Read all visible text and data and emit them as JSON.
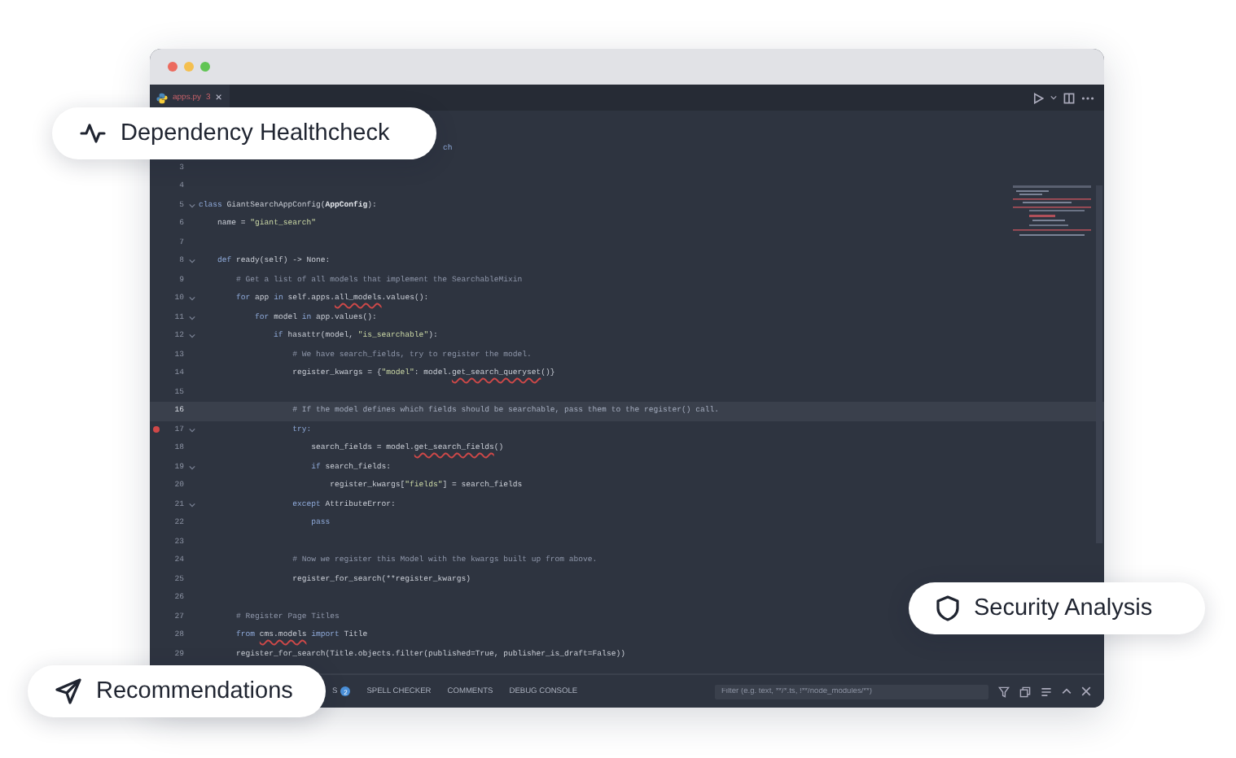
{
  "partial_code_line": {
    "text": "ch"
  },
  "editor_tab": {
    "label": "apps.py",
    "count": "3",
    "close": "×"
  },
  "code_lines": [
    {
      "number": "3",
      "fold": false,
      "highlighted": false,
      "breakpoint": false
    },
    {
      "number": "4",
      "fold": false,
      "highlighted": false,
      "breakpoint": false
    },
    {
      "number": "5",
      "fold": true,
      "highlighted": false,
      "breakpoint": false,
      "segments": [
        {
          "text": "class ",
          "kind": "keyword"
        },
        {
          "text": "GiantSearchAppConfig(",
          "kind": "plain"
        },
        {
          "text": "AppConfig",
          "kind": "bold"
        },
        {
          "text": "):",
          "kind": "plain"
        }
      ]
    },
    {
      "number": "6",
      "fold": false,
      "highlighted": false,
      "breakpoint": false,
      "segments": [
        {
          "text": "    name = ",
          "kind": "plain"
        },
        {
          "text": "\"giant_search\"",
          "kind": "string"
        }
      ]
    },
    {
      "number": "7",
      "fold": false,
      "highlighted": false,
      "breakpoint": false
    },
    {
      "number": "8",
      "fold": true,
      "highlighted": false,
      "breakpoint": false,
      "segments": [
        {
          "text": "    def ",
          "kind": "keyword"
        },
        {
          "text": "ready(self) -> None:",
          "kind": "plain"
        }
      ]
    },
    {
      "number": "9",
      "fold": false,
      "highlighted": false,
      "breakpoint": false,
      "segments": [
        {
          "text": "        # Get a list of all models that implement the SearchableMixin",
          "kind": "comment"
        }
      ]
    },
    {
      "number": "10",
      "fold": true,
      "highlighted": false,
      "breakpoint": false,
      "segments": [
        {
          "text": "        for ",
          "kind": "keyword"
        },
        {
          "text": "app ",
          "kind": "plain"
        },
        {
          "text": "in ",
          "kind": "keyword"
        },
        {
          "text": "self.apps.",
          "kind": "plain"
        },
        {
          "text": "all_models",
          "kind": "error"
        },
        {
          "text": ".values():",
          "kind": "plain"
        }
      ]
    },
    {
      "number": "11",
      "fold": true,
      "highlighted": false,
      "breakpoint": false,
      "segments": [
        {
          "text": "            for ",
          "kind": "keyword"
        },
        {
          "text": "model ",
          "kind": "plain"
        },
        {
          "text": "in ",
          "kind": "keyword"
        },
        {
          "text": "app.values():",
          "kind": "plain"
        }
      ]
    },
    {
      "number": "12",
      "fold": true,
      "highlighted": false,
      "breakpoint": false,
      "segments": [
        {
          "text": "                if ",
          "kind": "keyword"
        },
        {
          "text": "hasattr(model, ",
          "kind": "plain"
        },
        {
          "text": "\"is_searchable\"",
          "kind": "string"
        },
        {
          "text": "):",
          "kind": "plain"
        }
      ]
    },
    {
      "number": "13",
      "fold": false,
      "highlighted": false,
      "breakpoint": false,
      "segments": [
        {
          "text": "                    # We have search_fields, try to register the model.",
          "kind": "comment"
        }
      ]
    },
    {
      "number": "14",
      "fold": false,
      "highlighted": false,
      "breakpoint": false,
      "segments": [
        {
          "text": "                    register_kwargs = {",
          "kind": "plain"
        },
        {
          "text": "\"model\"",
          "kind": "string"
        },
        {
          "text": ": model.",
          "kind": "plain"
        },
        {
          "text": "get_search_queryset",
          "kind": "error"
        },
        {
          "text": "()}",
          "kind": "plain"
        }
      ]
    },
    {
      "number": "15",
      "fold": false,
      "highlighted": false,
      "breakpoint": false
    },
    {
      "number": "16",
      "fold": false,
      "highlighted": true,
      "breakpoint": false,
      "segments": [
        {
          "text": "                    # If the model defines which fields should be searchable, pass them to the register() call.",
          "kind": "comment"
        }
      ]
    },
    {
      "number": "17",
      "fold": true,
      "highlighted": false,
      "breakpoint": true,
      "segments": [
        {
          "text": "                    try:",
          "kind": "keyword"
        }
      ]
    },
    {
      "number": "18",
      "fold": false,
      "highlighted": false,
      "breakpoint": false,
      "segments": [
        {
          "text": "                        search_fields = model.",
          "kind": "plain"
        },
        {
          "text": "get_search_fields",
          "kind": "error"
        },
        {
          "text": "()",
          "kind": "plain"
        }
      ]
    },
    {
      "number": "19",
      "fold": true,
      "highlighted": false,
      "breakpoint": false,
      "segments": [
        {
          "text": "                        if ",
          "kind": "keyword"
        },
        {
          "text": "search_fields:",
          "kind": "plain"
        }
      ]
    },
    {
      "number": "20",
      "fold": false,
      "highlighted": false,
      "breakpoint": false,
      "segments": [
        {
          "text": "                            register_kwargs[",
          "kind": "plain"
        },
        {
          "text": "\"fields\"",
          "kind": "string"
        },
        {
          "text": "] = search_fields",
          "kind": "plain"
        }
      ]
    },
    {
      "number": "21",
      "fold": true,
      "highlighted": false,
      "breakpoint": false,
      "segments": [
        {
          "text": "                    except ",
          "kind": "keyword"
        },
        {
          "text": "AttributeError:",
          "kind": "plain"
        }
      ]
    },
    {
      "number": "22",
      "fold": false,
      "highlighted": false,
      "breakpoint": false,
      "segments": [
        {
          "text": "                        pass",
          "kind": "keyword"
        }
      ]
    },
    {
      "number": "23",
      "fold": false,
      "highlighted": false,
      "breakpoint": false
    },
    {
      "number": "24",
      "fold": false,
      "highlighted": false,
      "breakpoint": false,
      "segments": [
        {
          "text": "                    # Now we register this Model with the kwargs built up from above.",
          "kind": "comment"
        }
      ]
    },
    {
      "number": "25",
      "fold": false,
      "highlighted": false,
      "breakpoint": false,
      "segments": [
        {
          "text": "                    register_for_search(**register_kwargs)",
          "kind": "plain"
        }
      ]
    },
    {
      "number": "26",
      "fold": false,
      "highlighted": false,
      "breakpoint": false
    },
    {
      "number": "27",
      "fold": false,
      "highlighted": false,
      "breakpoint": false,
      "segments": [
        {
          "text": "        # Register Page Titles",
          "kind": "comment"
        }
      ]
    },
    {
      "number": "28",
      "fold": false,
      "highlighted": false,
      "breakpoint": false,
      "segments": [
        {
          "text": "        from ",
          "kind": "keyword"
        },
        {
          "text": "cms.models",
          "kind": "error"
        },
        {
          "text": " import ",
          "kind": "keyword"
        },
        {
          "text": "Title",
          "kind": "plain"
        }
      ]
    },
    {
      "number": "29",
      "fold": false,
      "highlighted": false,
      "breakpoint": false,
      "segments": [
        {
          "text": "        register_for_search(Title.objects.filter(published=True, publisher_is_draft=False))",
          "kind": "plain"
        }
      ]
    }
  ],
  "panel_tabs": [
    {
      "label": "S",
      "count": "2"
    },
    {
      "label": "SPELL CHECKER"
    },
    {
      "label": "COMMENTS"
    },
    {
      "label": "DEBUG CONSOLE"
    }
  ],
  "panel_filter": {
    "placeholder": "Filter (e.g. text, **/*.ts, !**/node_modules/**)"
  },
  "callouts": [
    {
      "kind": "pulse",
      "label": "Dependency Healthcheck"
    },
    {
      "kind": "shield",
      "label": "Security Analysis"
    },
    {
      "kind": "send",
      "label": "Recommendations"
    }
  ]
}
